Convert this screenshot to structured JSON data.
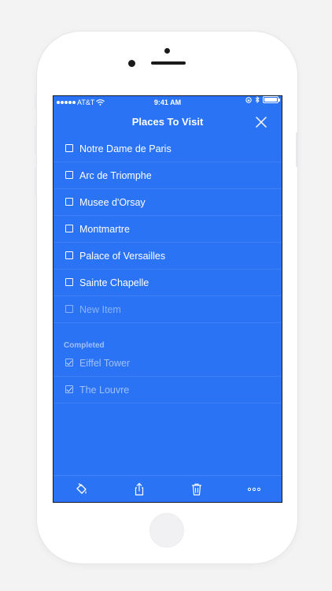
{
  "status_bar": {
    "carrier": "AT&T",
    "time": "9:41 AM",
    "signal_icon": "signal-dots-icon",
    "wifi_icon": "wifi-icon",
    "lock_icon": "rotation-lock-icon",
    "bluetooth_icon": "bluetooth-icon",
    "battery_icon": "battery-icon",
    "battery_level": 1.0
  },
  "nav": {
    "title": "Places To Visit",
    "close_icon": "close-icon"
  },
  "items": [
    {
      "label": "Notre Dame de Paris",
      "checked": false
    },
    {
      "label": "Arc de Triomphe",
      "checked": false
    },
    {
      "label": "Musee d'Orsay",
      "checked": false
    },
    {
      "label": "Montmartre",
      "checked": false
    },
    {
      "label": "Palace of Versailles",
      "checked": false
    },
    {
      "label": "Sainte Chapelle",
      "checked": false
    }
  ],
  "new_item": {
    "placeholder": "New Item"
  },
  "completed": {
    "header": "Completed",
    "items": [
      {
        "label": "Eiffel Tower",
        "checked": true
      },
      {
        "label": "The Louvre",
        "checked": true
      }
    ]
  },
  "toolbar": {
    "tools": [
      "paint-bucket-icon",
      "share-icon",
      "trash-icon",
      "more-icon"
    ]
  },
  "colors": {
    "screen_bg": "#2a73f4",
    "page_bg": "#f3f3f4",
    "device": "#ffffff"
  }
}
